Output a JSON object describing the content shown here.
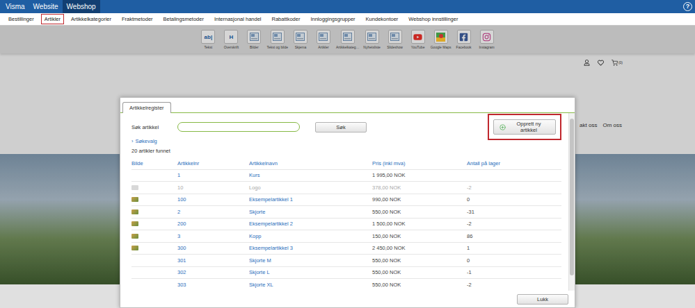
{
  "top_bar": {
    "items": [
      {
        "label": "Visma",
        "selected": false
      },
      {
        "label": "Website",
        "selected": false
      },
      {
        "label": "Webshop",
        "selected": true
      }
    ],
    "help": "?"
  },
  "tabs": [
    {
      "label": "Bestillinger",
      "selected": false
    },
    {
      "label": "Artikler",
      "selected": true
    },
    {
      "label": "Artikkelkategorier",
      "selected": false
    },
    {
      "label": "Fraktmetoder",
      "selected": false
    },
    {
      "label": "Betalingsmetoder",
      "selected": false
    },
    {
      "label": "Internasjonal handel",
      "selected": false
    },
    {
      "label": "Rabattkoder",
      "selected": false
    },
    {
      "label": "Innloggingsgrupper",
      "selected": false
    },
    {
      "label": "Kundekontoer",
      "selected": false
    },
    {
      "label": "Webshop innstillinger",
      "selected": false
    }
  ],
  "editor_toolbar": [
    {
      "label": "Tekst",
      "kind": "text",
      "glyph": "ab|"
    },
    {
      "label": "Overskrift",
      "kind": "heading",
      "glyph": "H"
    },
    {
      "label": "Bilder",
      "kind": "image",
      "glyph": ""
    },
    {
      "label": "Tekst og bilde",
      "kind": "text-image",
      "glyph": ""
    },
    {
      "label": "Skjema",
      "kind": "form",
      "glyph": ""
    },
    {
      "label": "Artikler",
      "kind": "articles",
      "glyph": ""
    },
    {
      "label": "Artikkelkateg…",
      "kind": "categories",
      "glyph": ""
    },
    {
      "label": "Nyhetsliste",
      "kind": "news",
      "glyph": ""
    },
    {
      "label": "Slideshow",
      "kind": "slideshow",
      "glyph": ""
    },
    {
      "label": "YouTube",
      "kind": "youtube",
      "glyph": ""
    },
    {
      "label": "Google Maps",
      "kind": "maps",
      "glyph": ""
    },
    {
      "label": "Facebook",
      "kind": "facebook",
      "glyph": ""
    },
    {
      "label": "Instagram",
      "kind": "instagram",
      "glyph": ""
    }
  ],
  "page": {
    "cart_count": "(0)",
    "nav": [
      "akt oss",
      "Om oss"
    ]
  },
  "dialog": {
    "tab": {
      "label": "Artikkelregister",
      "selected": true
    },
    "search": {
      "label": "Søk artikkel",
      "value": "",
      "button": "Søk"
    },
    "create_button": {
      "label": "Opprett ny artikkel",
      "highlighted": true
    },
    "search_options": {
      "icon": "›",
      "label": "Søkevalg",
      "expanded": false
    },
    "result_count": "20 artikler funnet",
    "table": {
      "columns": [
        "Bilde",
        "Artikkelnr",
        "Artikkelnavn",
        "Pris (inkl mva)",
        "Antall på lager"
      ],
      "rows": [
        {
          "thumbnail": false,
          "number": "1",
          "name": "Kurs",
          "price": "1 995,00 NOK",
          "stock": "",
          "disabled": false
        },
        {
          "thumbnail": true,
          "number": "10",
          "name": "Logo",
          "price": "378,00 NOK",
          "stock": "-2",
          "disabled": true
        },
        {
          "thumbnail": true,
          "number": "100",
          "name": "Eksempelartikkel 1",
          "price": "990,00 NOK",
          "stock": "0",
          "disabled": false
        },
        {
          "thumbnail": true,
          "number": "2",
          "name": "Skjorte",
          "price": "550,00 NOK",
          "stock": "-31",
          "disabled": false
        },
        {
          "thumbnail": true,
          "number": "200",
          "name": "Eksempelartikkel 2",
          "price": "1 500,00 NOK",
          "stock": "-2",
          "disabled": false
        },
        {
          "thumbnail": true,
          "number": "3",
          "name": "Kopp",
          "price": "150,00 NOK",
          "stock": "86",
          "disabled": false
        },
        {
          "thumbnail": true,
          "number": "300",
          "name": "Eksempelartikkel 3",
          "price": "2 450,00 NOK",
          "stock": "1",
          "disabled": false
        },
        {
          "thumbnail": false,
          "number": "301",
          "name": "Skjorte M",
          "price": "550,00 NOK",
          "stock": "0",
          "disabled": false
        },
        {
          "thumbnail": false,
          "number": "302",
          "name": "Skjorte L",
          "price": "550,00 NOK",
          "stock": "-1",
          "disabled": false
        },
        {
          "thumbnail": false,
          "number": "303",
          "name": "Skjorte XL",
          "price": "550,00 NOK",
          "stock": "-2",
          "disabled": false
        }
      ]
    },
    "scrollbar": {
      "level": 0.94
    },
    "close_button": "Lukk"
  }
}
